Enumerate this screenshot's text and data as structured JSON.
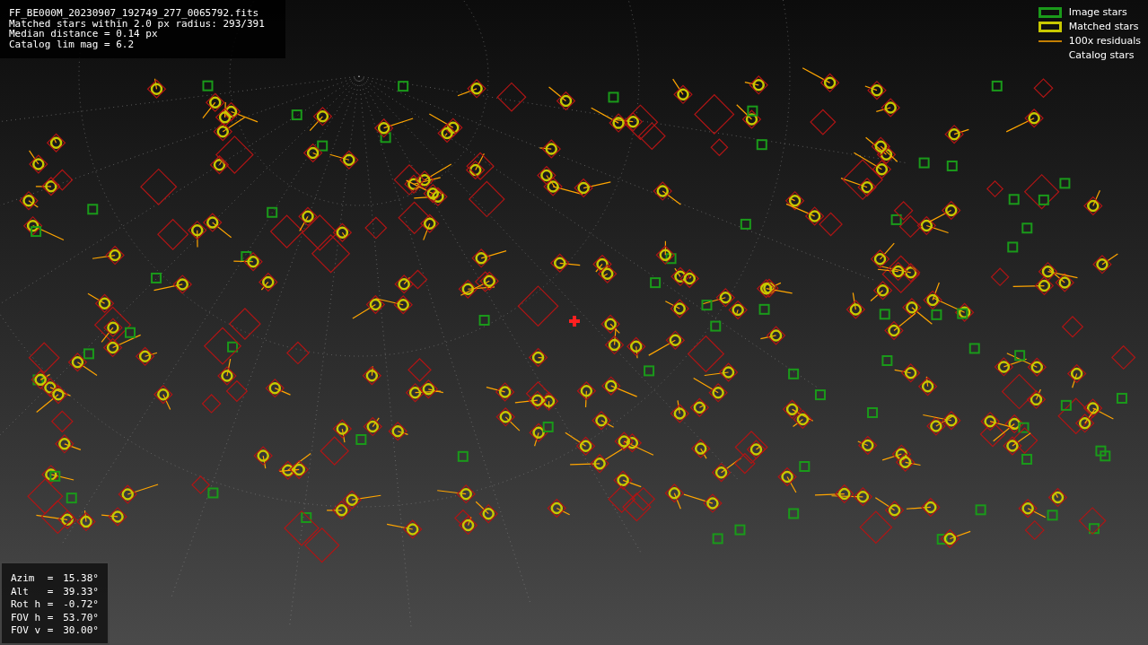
{
  "info": {
    "lines": [
      "FF_BE000M_20230907_192749_277_0065792.fits",
      "Matched stars within 2.0 px radius: 293/391",
      "Median distance = 0.14 px",
      "Catalog lim mag = 6.2"
    ]
  },
  "legend": [
    {
      "kind": "image",
      "label": "Image stars"
    },
    {
      "kind": "matched",
      "label": "Matched stars"
    },
    {
      "kind": "residual",
      "label": "100x residuals"
    },
    {
      "kind": "catalog",
      "label": "Catalog stars"
    }
  ],
  "pointing": [
    {
      "label": "Azim",
      "sep": "=",
      "value": "15.38°"
    },
    {
      "label": "Alt",
      "sep": "=",
      "value": "39.33°"
    },
    {
      "label": "Rot h",
      "sep": "=",
      "value": "-0.72°"
    },
    {
      "label": "FOV h",
      "sep": "=",
      "value": "53.70°"
    },
    {
      "label": "FOV v",
      "sep": "=",
      "value": "30.00°"
    }
  ]
}
